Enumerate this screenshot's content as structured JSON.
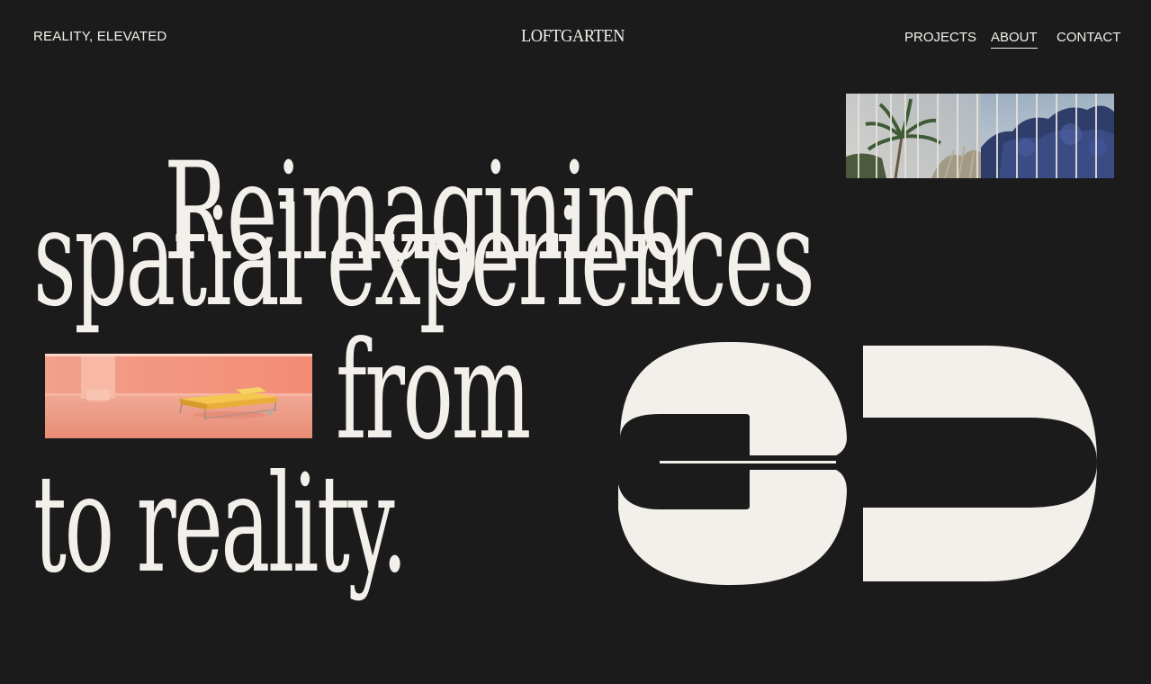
{
  "header": {
    "tagline": "REALITY, ELEVATED",
    "logo": "LOFTGARTEN",
    "nav": [
      {
        "label": "PROJECTS",
        "active": false
      },
      {
        "label": "ABOUT",
        "active": true
      },
      {
        "label": "CONTACT",
        "active": false
      }
    ]
  },
  "hero": {
    "line1": "Reimagining",
    "line2": "spatial experiences",
    "line3": "from",
    "line4": "to reality.",
    "graphic_text": "3D"
  },
  "colors": {
    "background": "#1b1b1b",
    "foreground": "#f3f0eb",
    "room_accent": "#f0937c",
    "sofa": "#e8b23e",
    "sky": "#a8b7c6"
  }
}
